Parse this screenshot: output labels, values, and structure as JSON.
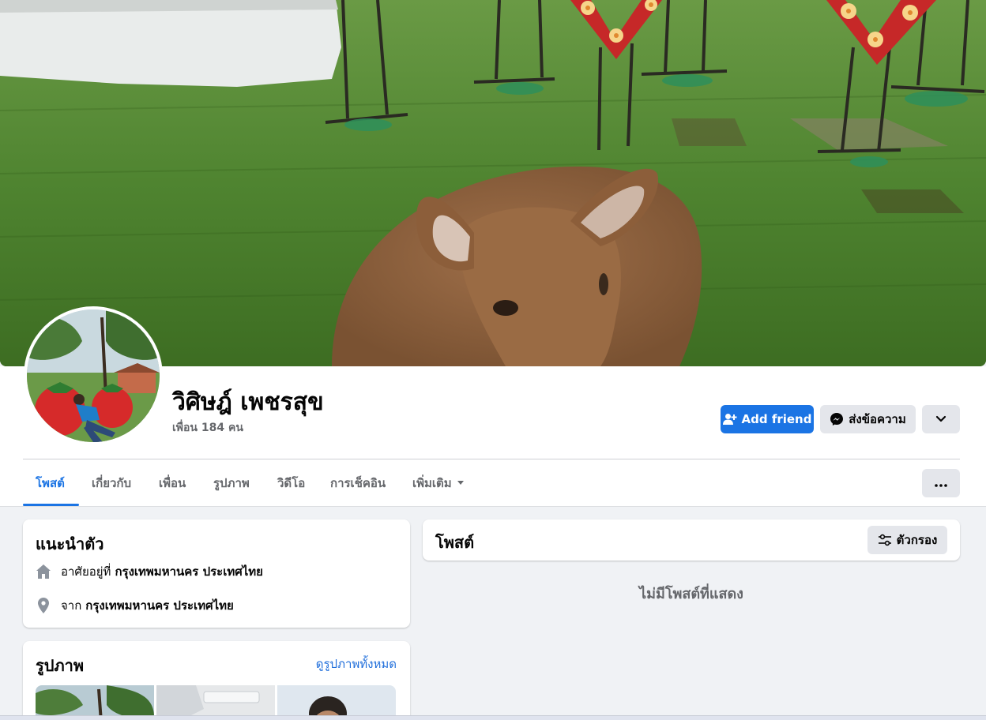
{
  "profile": {
    "name": "วิศิษฎ์ เพชรสุข",
    "friends_text": "เพื่อน 184 คน"
  },
  "actions": {
    "add_friend": "Add friend",
    "message": "ส่งข้อความ"
  },
  "tabs": [
    {
      "label": "โพสต์",
      "active": true
    },
    {
      "label": "เกี่ยวกับ"
    },
    {
      "label": "เพื่อน"
    },
    {
      "label": "รูปภาพ"
    },
    {
      "label": "วิดีโอ"
    },
    {
      "label": "การเช็คอิน"
    },
    {
      "label": "เพิ่มเติม"
    }
  ],
  "intro": {
    "title": "แนะนำตัว",
    "lives_prefix": "อาศัยอยู่ที่",
    "lives_place": "กรุงเทพมหานคร ประเทศไทย",
    "from_prefix": "จาก",
    "from_place": "กรุงเทพมหานคร ประเทศไทย"
  },
  "photos": {
    "title": "รูปภาพ",
    "see_all": "ดูรูปภาพทั้งหมด"
  },
  "posts": {
    "title": "โพสต์",
    "filter_label": "ตัวกรอง",
    "empty_text": "ไม่มีโพสต์ที่แสดง"
  },
  "colors": {
    "accent": "#1b74e4",
    "page_background": "#f0f2f5",
    "secondary_button": "#e4e6eb"
  }
}
